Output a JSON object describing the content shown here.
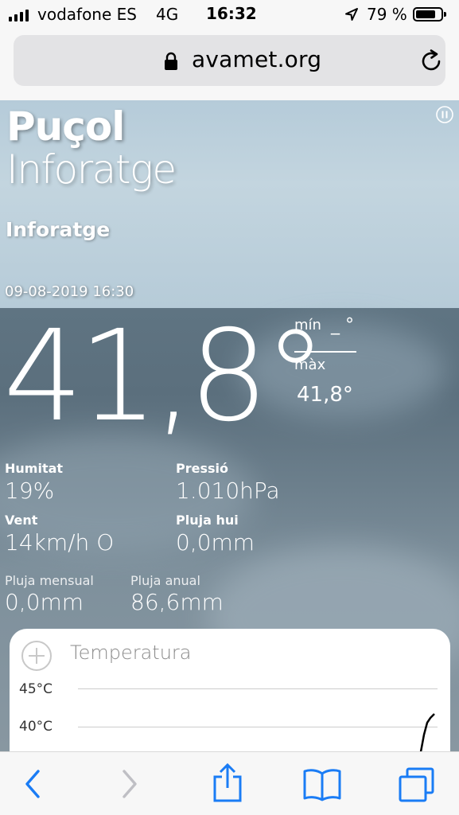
{
  "status": {
    "carrier": "vodafone ES",
    "network": "4G",
    "time": "16:32",
    "battery": "79 %",
    "battery_level": 0.79,
    "icons": [
      "signal-icon",
      "location-icon",
      "battery-icon"
    ]
  },
  "browser": {
    "url": "avamet.org",
    "icons": [
      "lock-icon",
      "reload-icon"
    ]
  },
  "hero": {
    "city": "Puçol",
    "subtitle": "Inforatge",
    "station": "Inforatge",
    "datetime": "09-08-2019 16:30"
  },
  "current": {
    "temperature": "41,8°",
    "min_label": "mín",
    "min_value": "_ °",
    "max_label": "màx",
    "max_value": "41,8°"
  },
  "metrics": {
    "humidity_label": "Humitat",
    "humidity_value": "19%",
    "pressure_label": "Pressió",
    "pressure_value": "1.010hPa",
    "wind_label": "Vent",
    "wind_value": "14km/h O",
    "rain_today_label": "Pluja hui",
    "rain_today_value": "0,0mm",
    "rain_month_label": "Pluja mensual",
    "rain_month_value": "0,0mm",
    "rain_year_label": "Pluja anual",
    "rain_year_value": "86,6mm"
  },
  "chart": {
    "title": "Temperatura",
    "ticks": [
      "45°C",
      "40°C"
    ]
  },
  "colors": {
    "accent": "#1a7cf5",
    "disabled": "#bfbfc4"
  },
  "toolbar": {
    "icons": [
      "back-icon",
      "forward-icon",
      "share-icon",
      "bookmarks-icon",
      "tabs-icon"
    ]
  }
}
